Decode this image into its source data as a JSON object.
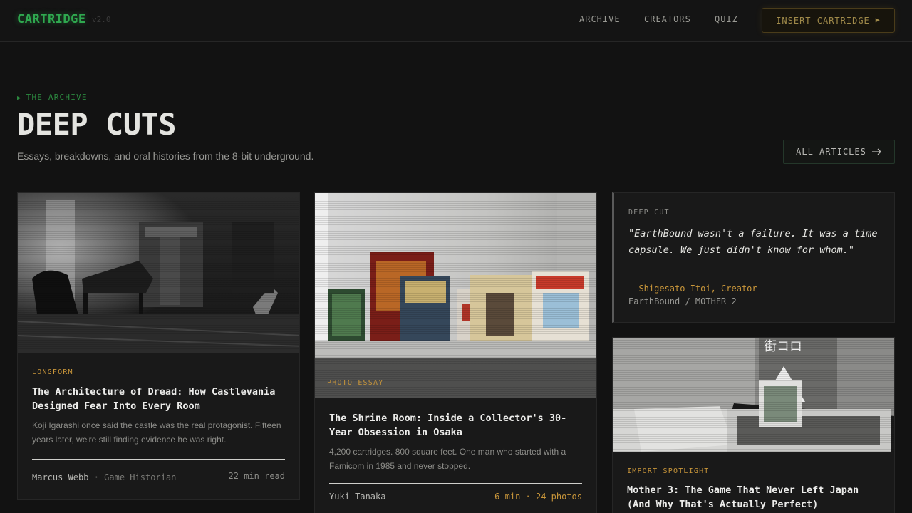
{
  "nav": {
    "logo": "CARTRIDGE",
    "version": "v2.0",
    "links": [
      "ARCHIVE",
      "CREATORS",
      "QUIZ"
    ],
    "cta": "INSERT CARTRIDGE",
    "cta_icon": "play-triangle-icon"
  },
  "hero": {
    "eyebrow": "THE ARCHIVE",
    "title": "DEEP CUTS",
    "subtitle": "Essays, breakdowns, and oral histories from the 8-bit underground.",
    "all_articles": "ALL ARTICLES",
    "all_articles_icon": "arrow-right-icon"
  },
  "articles": [
    {
      "tag": "LONGFORM",
      "title": "The Architecture of Dread: How Castlevania Designed Fear Into Every Room",
      "desc": "Koji Igarashi once said the castle was the real protagonist. Fifteen years later, we're still finding evidence he was right.",
      "author": "Marcus Webb",
      "role": "Game Historian",
      "meta": "22 min read",
      "image": "abandoned-piano-room-photo"
    },
    {
      "tag": "PHOTO ESSAY",
      "title": "The Shrine Room: Inside a Collector's 30-Year Obsession in Osaka",
      "desc": "4,200 cartridges. 800 square feet. One man who started with a Famicom in 1985 and never stopped.",
      "author": "Yuki Tanaka",
      "meta": "6 min · 24 photos",
      "image": "game-boxes-shelf-photo"
    },
    {
      "tag": "IMPORT SPOTLIGHT",
      "title": "Mother 3: The Game That Never Left Japan (And Why That's Actually Perfect)",
      "image": "import-game-boxes-photo"
    }
  ],
  "quote": {
    "tag": "DEEP CUT",
    "text": "\"EarthBound wasn't a failure. It was a time capsule. We just didn't know for whom.\"",
    "attribution": "— Shigesato Itoi, Creator",
    "source": "EarthBound / MOTHER 2"
  },
  "colors": {
    "background": "#121212",
    "accent_green": "#2fa84f",
    "accent_gold": "#c9963a",
    "card": "#191919"
  }
}
